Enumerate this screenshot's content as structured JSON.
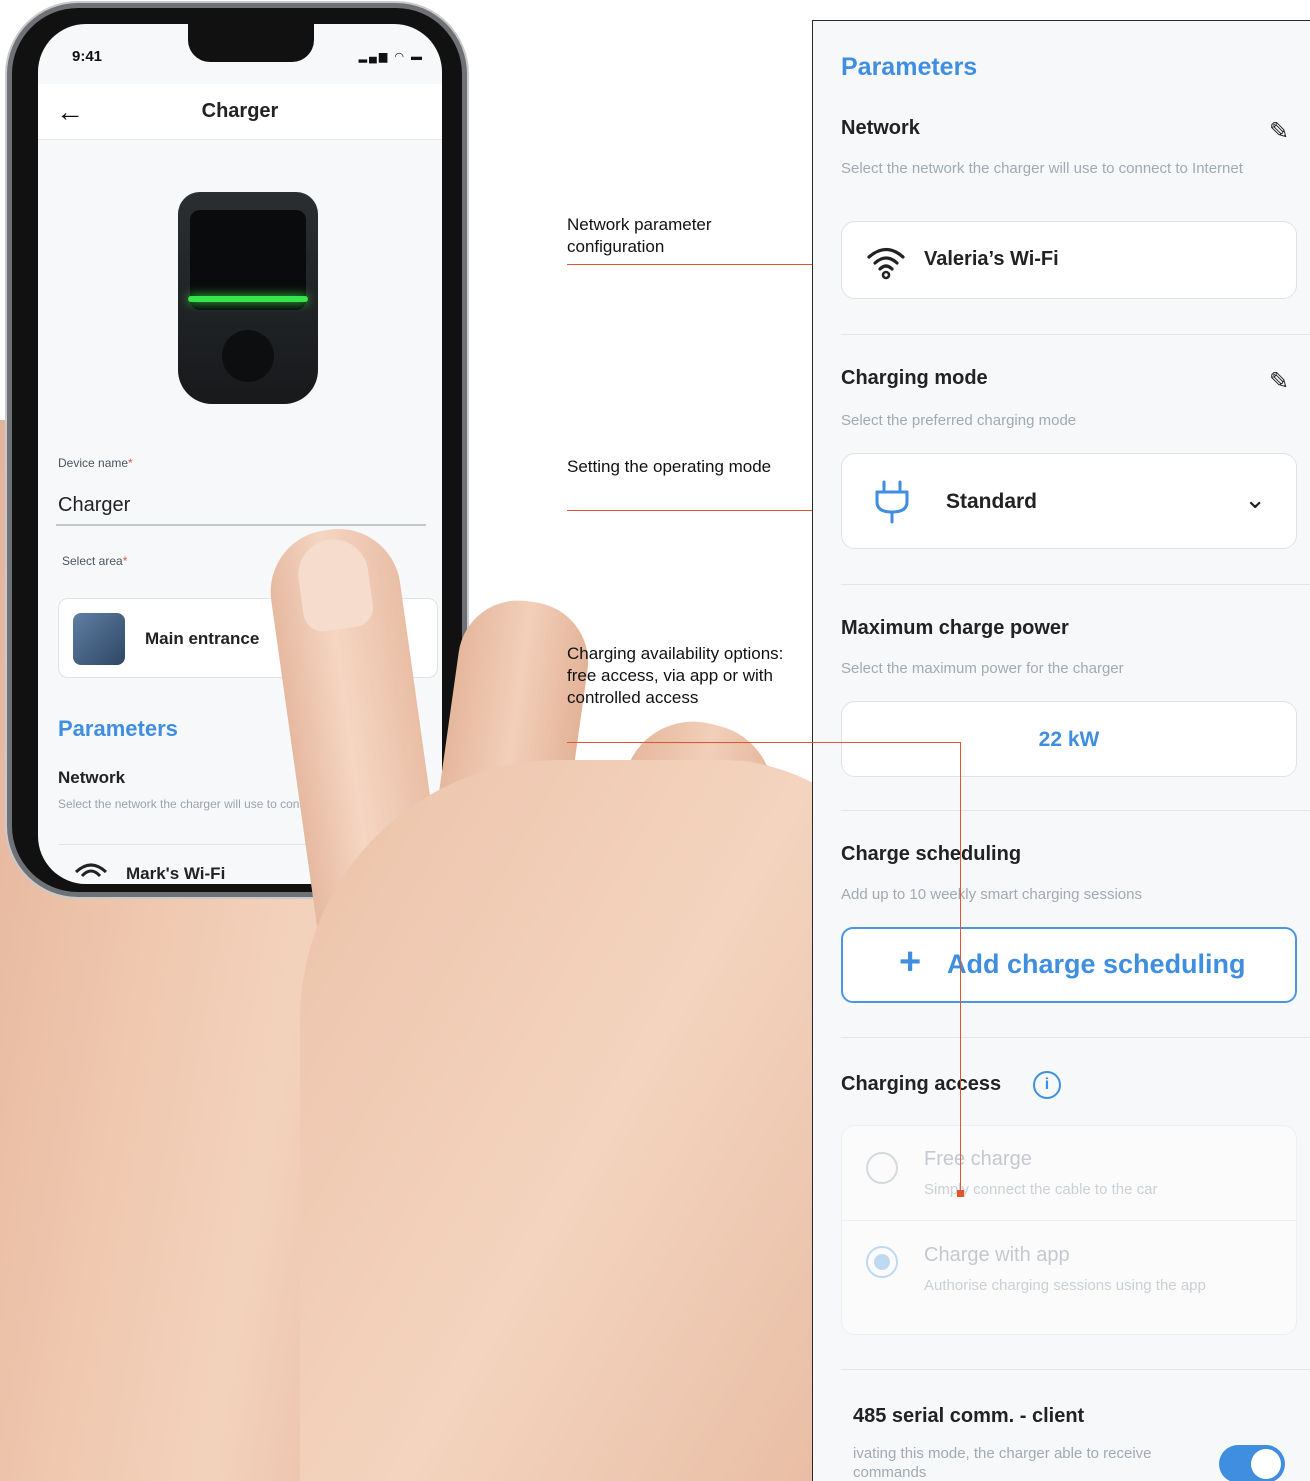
{
  "phone": {
    "status_time": "9:41",
    "status_icons": "▂▄▆ ◠ ▬",
    "header_title": "Charger",
    "device_name_label": "Device name",
    "device_name_value": "Charger",
    "select_area_label": "Select area",
    "area_value": "Main entrance",
    "section_title": "Parameters",
    "network_title": "Network",
    "network_desc": "Select the network the charger will use to connect to internet",
    "network_value": "Mark's Wi-Fi",
    "required_mark": "*"
  },
  "annotations": {
    "network": "Network parameter configuration",
    "mode": "Setting the operating mode",
    "access": "Charging availability options: free access, via app or with controlled access"
  },
  "panel": {
    "title": "Parameters",
    "network": {
      "title": "Network",
      "desc": "Select the network the charger will use to connect to Internet",
      "value": "Valeria’s Wi-Fi"
    },
    "charging_mode": {
      "title": "Charging mode",
      "desc": "Select the preferred charging mode",
      "value": "Standard"
    },
    "max_power": {
      "title": "Maximum charge power",
      "desc": "Select the maximum power for the charger",
      "value": "22 kW"
    },
    "scheduling": {
      "title": "Charge scheduling",
      "desc": "Add up to 10 weekly smart charging sessions",
      "button_label": "Add charge scheduling"
    },
    "access": {
      "title": "Charging access",
      "options": [
        {
          "title": "Free charge",
          "desc": "Simply connect the cable to the car",
          "selected": false
        },
        {
          "title": "Charge with app",
          "desc": "Authorise charging sessions using the app",
          "selected": true
        }
      ]
    },
    "serial": {
      "title": "485 serial comm. - client",
      "desc": "ivating this mode, the charger able to receive commands",
      "enabled": true
    }
  },
  "colors": {
    "accent": "#3f8ee0",
    "annotation_line": "#e4552f",
    "led": "#37e54b"
  }
}
